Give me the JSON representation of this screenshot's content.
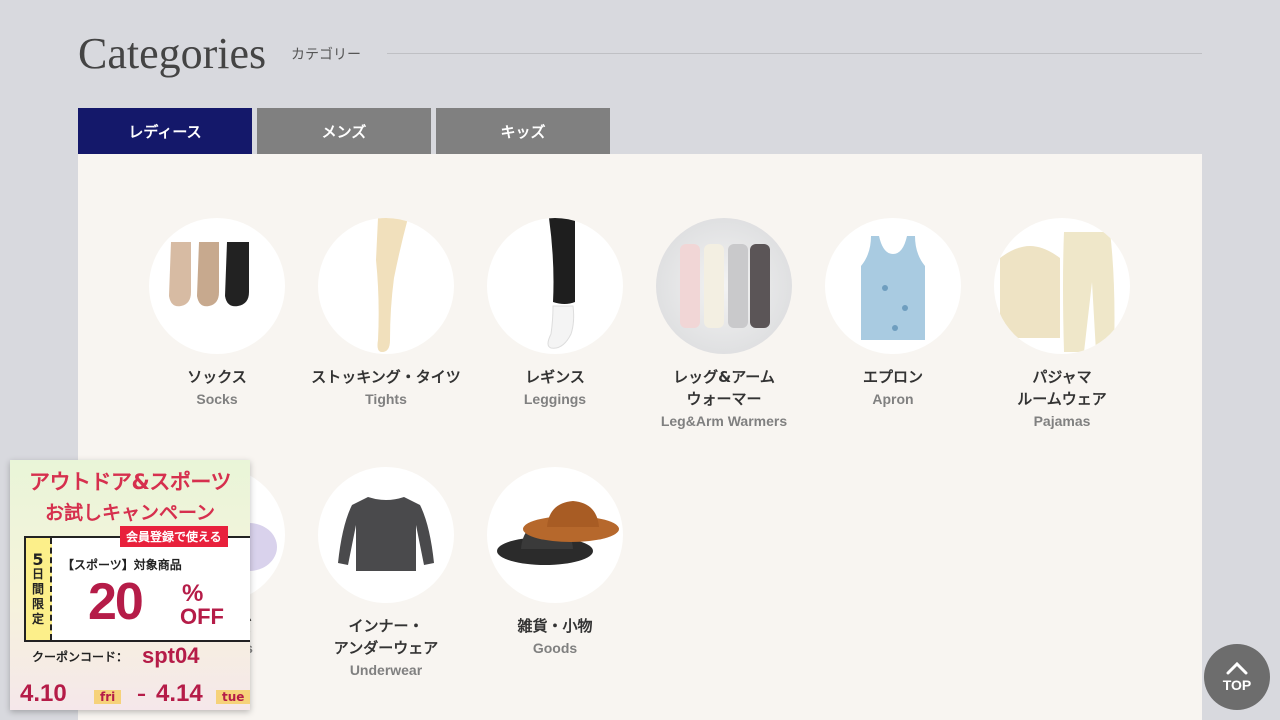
{
  "header": {
    "title": "Categories",
    "subtitle": "カテゴリー"
  },
  "tabs": [
    {
      "label": "レディース",
      "active": true
    },
    {
      "label": "メンズ",
      "active": false
    },
    {
      "label": "キッズ",
      "active": false
    }
  ],
  "categories": [
    {
      "jp": "ソックス",
      "en": "Socks",
      "icon": "socks-icon"
    },
    {
      "jp": "ストッキング・タイツ",
      "en": "Tights",
      "icon": "tights-icon"
    },
    {
      "jp": "レギンス",
      "en": "Leggings",
      "icon": "leggings-icon"
    },
    {
      "jp": "レッグ&アーム\nウォーマー",
      "jp1": "レッグ&アーム",
      "jp2": "ウォーマー",
      "en": "Leg&Arm Warmers",
      "icon": "warmers-icon"
    },
    {
      "jp": "エプロン",
      "en": "Apron",
      "icon": "apron-icon"
    },
    {
      "jp1": "パジャマ",
      "jp2": "ルームウェア",
      "en": "Pajamas",
      "icon": "pajamas-icon"
    },
    {
      "jp": "ーズ",
      "en": "s",
      "icon": "slippers-icon"
    },
    {
      "jp1": "インナー・",
      "jp2": "アンダーウェア",
      "en": "Underwear",
      "icon": "underwear-icon"
    },
    {
      "jp": "雑貨・小物",
      "en": "Goods",
      "icon": "hat-icon"
    }
  ],
  "banner": {
    "line1": "アウトドア&スポーツ",
    "line2": "お試しキャンペーン",
    "tag": "会員登録で使える",
    "side": [
      "5",
      "日",
      "間",
      "限",
      "定"
    ],
    "target": "【スポーツ】対象商品",
    "discount": "20",
    "percent": "%",
    "off": "OFF",
    "coupon_label": "クーポンコード：",
    "coupon_code": "spt04",
    "start_date": "4.10",
    "start_day": "fri",
    "end_date": "4.14",
    "end_day": "tue",
    "dash": "–"
  },
  "top_button": {
    "label": "TOP"
  },
  "colors": {
    "active_tab": "#14186a",
    "inactive_tab": "#808080",
    "panel": "#f8f5f1",
    "background": "#d8d9de",
    "accent": "#b51c48"
  }
}
